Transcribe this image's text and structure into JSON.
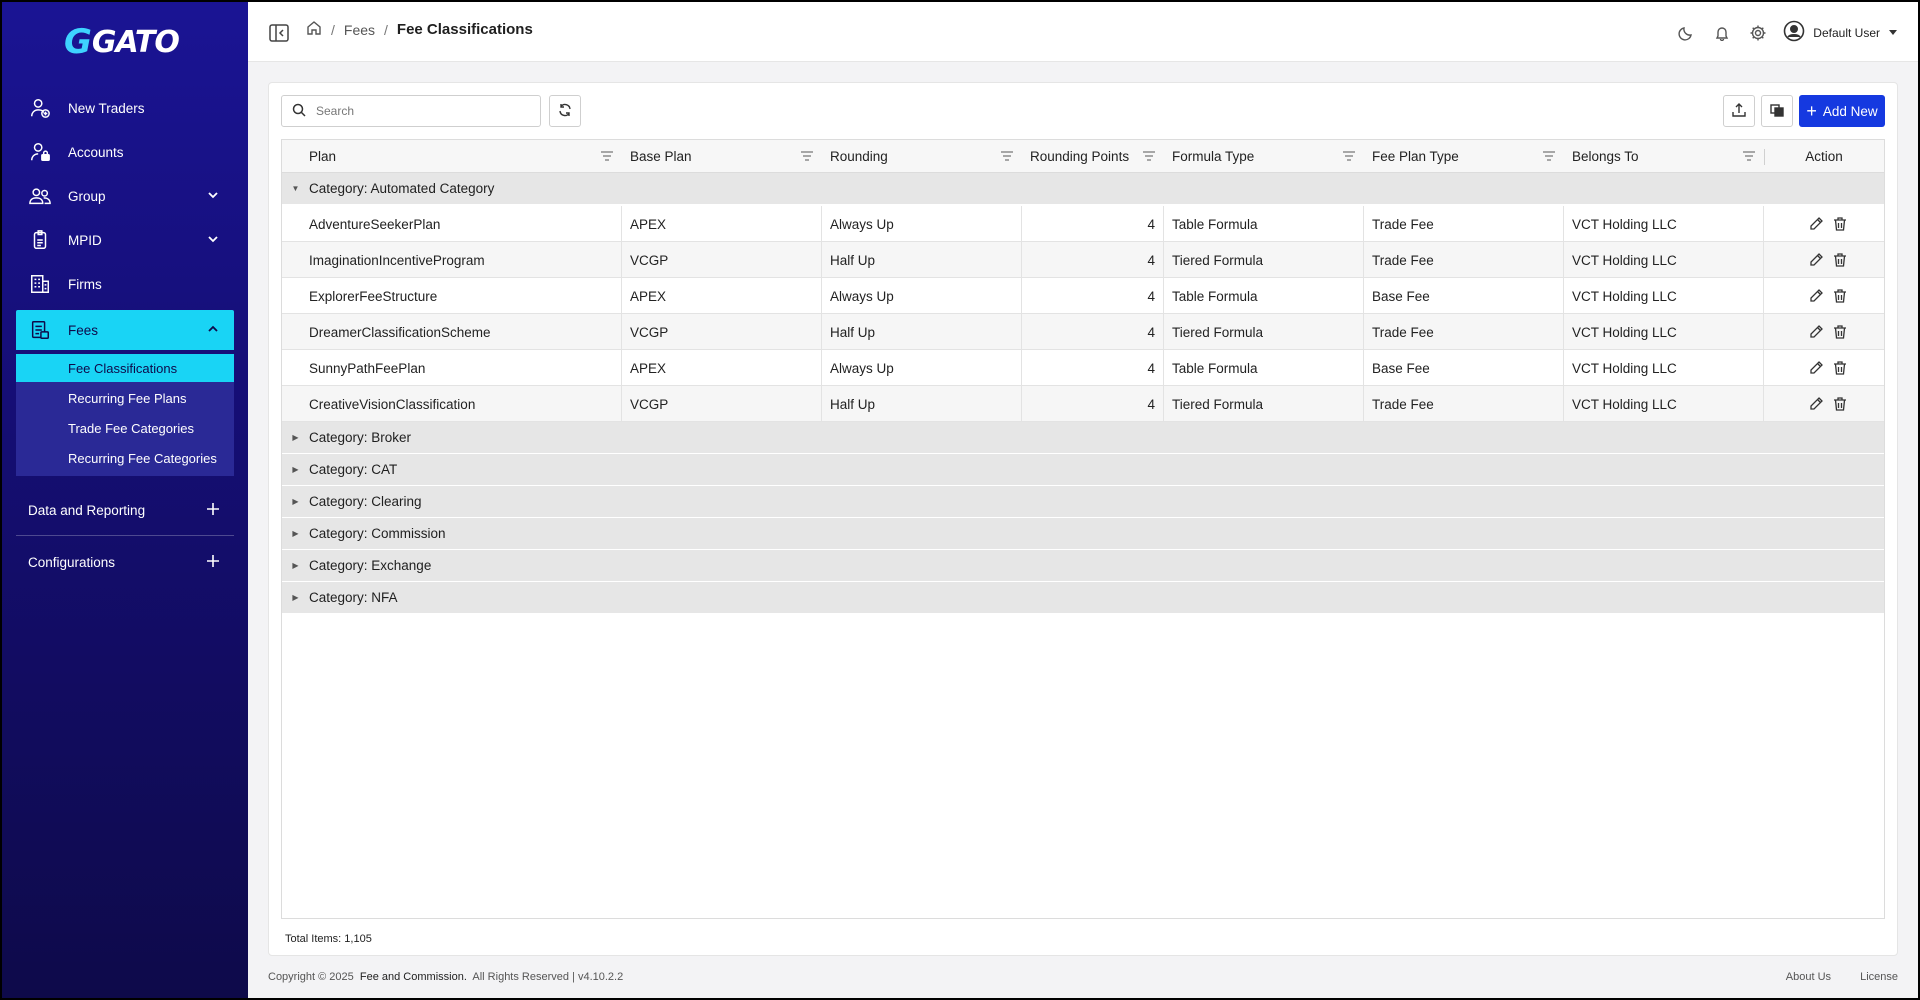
{
  "logo": {
    "mark": "G",
    "text": "GATO"
  },
  "sidebar": {
    "items": [
      {
        "label": "New Traders",
        "icon": "user-plus-icon"
      },
      {
        "label": "Accounts",
        "icon": "user-lock-icon"
      },
      {
        "label": "Group",
        "icon": "users-icon"
      },
      {
        "label": "MPID",
        "icon": "id-badge-icon"
      },
      {
        "label": "Firms",
        "icon": "building-icon"
      },
      {
        "label": "Fees",
        "icon": "receipt-icon"
      }
    ],
    "sub_items": [
      {
        "label": "Fee Classifications"
      },
      {
        "label": "Recurring Fee Plans"
      },
      {
        "label": "Trade Fee Categories"
      },
      {
        "label": "Recurring Fee Categories"
      }
    ],
    "sections": [
      {
        "label": "Data and Reporting"
      },
      {
        "label": "Configurations"
      }
    ]
  },
  "header": {
    "breadcrumb": {
      "parent": "Fees",
      "sep": "/",
      "current": "Fee Classifications"
    },
    "user": "Default User"
  },
  "toolbar": {
    "search_placeholder": "Search",
    "add_label": "Add New"
  },
  "table": {
    "columns": [
      "Plan",
      "Base Plan",
      "Rounding",
      "Rounding Points",
      "Formula Type",
      "Fee Plan Type",
      "Belongs To",
      "Action"
    ],
    "expanded_group": "Category: Automated Category",
    "rows": [
      {
        "plan": "AdventureSeekerPlan",
        "base": "APEX",
        "rounding": "Always Up",
        "points": "4",
        "formula": "Table Formula",
        "fee_type": "Trade Fee",
        "owner": "VCT Holding LLC"
      },
      {
        "plan": "ImaginationIncentiveProgram",
        "base": "VCGP",
        "rounding": "Half Up",
        "points": "4",
        "formula": "Tiered Formula",
        "fee_type": "Trade Fee",
        "owner": "VCT Holding LLC"
      },
      {
        "plan": "ExplorerFeeStructure",
        "base": "APEX",
        "rounding": "Always Up",
        "points": "4",
        "formula": "Table Formula",
        "fee_type": "Base Fee",
        "owner": "VCT Holding LLC"
      },
      {
        "plan": "DreamerClassificationScheme",
        "base": "VCGP",
        "rounding": "Half Up",
        "points": "4",
        "formula": "Tiered Formula",
        "fee_type": "Trade Fee",
        "owner": "VCT Holding LLC"
      },
      {
        "plan": "SunnyPathFeePlan",
        "base": "APEX",
        "rounding": "Always Up",
        "points": "4",
        "formula": "Table Formula",
        "fee_type": "Base Fee",
        "owner": "VCT Holding LLC"
      },
      {
        "plan": "CreativeVisionClassification",
        "base": "VCGP",
        "rounding": "Half Up",
        "points": "4",
        "formula": "Tiered Formula",
        "fee_type": "Trade Fee",
        "owner": "VCT Holding LLC"
      }
    ],
    "collapsed_groups": [
      "Category: Broker",
      "Category: CAT",
      "Category: Clearing",
      "Category: Commission",
      "Category: Exchange",
      "Category: NFA"
    ],
    "total": "Total Items: 1,105"
  },
  "footer": {
    "copyright": "Copyright © 2025",
    "product": "Fee and Commission.",
    "rights": "All Rights Reserved | v4.10.2.2",
    "about": "About Us",
    "license": "License"
  },
  "colors": {
    "accent": "#19d4f5",
    "primary": "#1539e0",
    "sidebar": "#150e75"
  }
}
